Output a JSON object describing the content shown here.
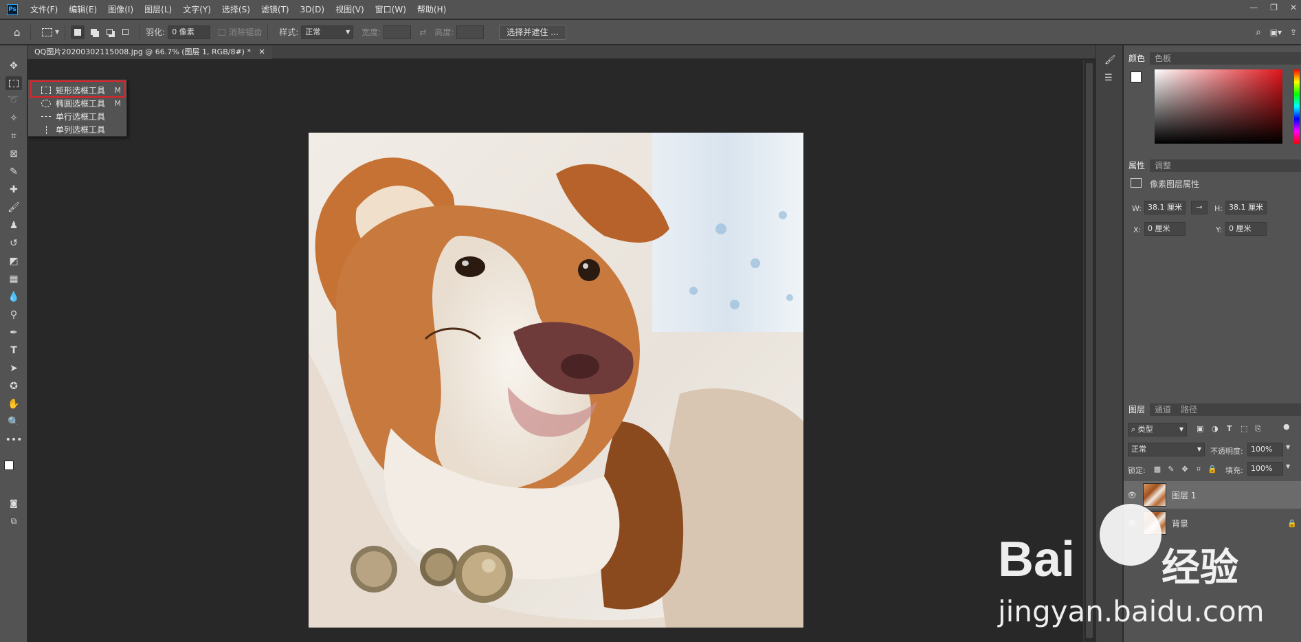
{
  "app": {
    "logo": "Ps"
  },
  "menu": [
    "文件(F)",
    "编辑(E)",
    "图像(I)",
    "图层(L)",
    "文字(Y)",
    "选择(S)",
    "滤镜(T)",
    "3D(D)",
    "视图(V)",
    "窗口(W)",
    "帮助(H)"
  ],
  "window_controls": [
    "—",
    "❐",
    "✕"
  ],
  "options": {
    "feather_label": "羽化:",
    "feather_value": "0 像素",
    "antialias_label": "消除锯齿",
    "style_label": "样式:",
    "style_value": "正常",
    "width_label": "宽度:",
    "height_label": "高度:",
    "select_mask_button": "选择并遮住 ..."
  },
  "document_tab": {
    "title": "QQ图片20200302115008.jpg @ 66.7% (图层 1, RGB/8#) *"
  },
  "flyout": {
    "items": [
      {
        "label": "矩形选框工具",
        "key": "M"
      },
      {
        "label": "椭圆选框工具",
        "key": "M"
      },
      {
        "label": "单行选框工具",
        "key": ""
      },
      {
        "label": "单列选框工具",
        "key": ""
      }
    ]
  },
  "color_panel": {
    "tabs": [
      "颜色",
      "色板"
    ]
  },
  "properties_panel": {
    "tabs": [
      "属性",
      "调整"
    ],
    "title": "像素图层属性",
    "w_label": "W:",
    "w_value": "38.1 厘米",
    "h_label": "H:",
    "h_value": "38.1 厘米",
    "x_label": "X:",
    "x_value": "0 厘米",
    "y_label": "Y:",
    "y_value": "0 厘米"
  },
  "layers_panel": {
    "tabs": [
      "图层",
      "通道",
      "路径"
    ],
    "filter_value": "类型",
    "blend_mode": "正常",
    "opacity_label": "不透明度:",
    "opacity_value": "100%",
    "lock_label": "锁定:",
    "fill_label": "填充:",
    "fill_value": "100%",
    "layers": [
      {
        "name": "图层 1",
        "selected": true
      },
      {
        "name": "背景",
        "selected": false
      }
    ]
  },
  "watermark": {
    "brand": "Bai",
    "brand2": "经验",
    "url": "jingyan.baidu.com"
  }
}
